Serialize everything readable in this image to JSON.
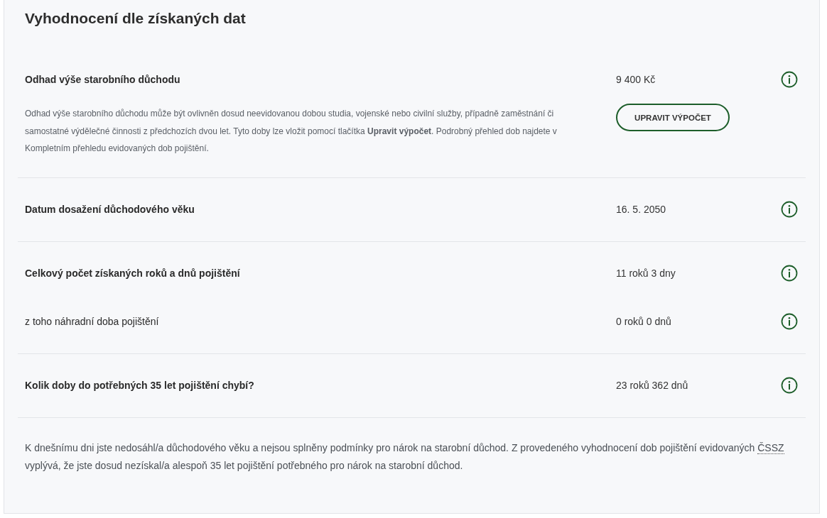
{
  "title": "Vyhodnocení dle získaných dat",
  "sections": [
    {
      "rows": [
        {
          "label": "Odhad výše starobního důchodu",
          "value": "9 400 Kč",
          "bold": true
        }
      ],
      "description": "Odhad výše starobního důchodu může být ovlivněn dosud neevidovanou dobou studia, vojenské nebo civilní služby, případně zaměstnání či samostatné výdělečné činnosti z předchozích dvou let. Tyto doby lze vložit pomocí tlačítka **Upravit výpočet**. Podrobný přehled dob najdete v Kompletním přehledu evidovaných dob pojištění.",
      "button": "UPRAVIT VÝPOČET"
    },
    {
      "rows": [
        {
          "label": "Datum dosažení důchodového věku",
          "value": "16. 5. 2050",
          "bold": true
        }
      ]
    },
    {
      "rows": [
        {
          "label": "Celkový počet získaných roků a dnů pojištění",
          "value": "11 roků 3 dny",
          "bold": true
        },
        {
          "label": "z toho náhradní doba pojištění",
          "value": "0 roků 0 dnů",
          "bold": false
        }
      ]
    },
    {
      "rows": [
        {
          "label": "Kolik doby do potřebných 35 let pojištění chybí?",
          "value": "23 roků 362 dnů",
          "bold": true
        }
      ]
    }
  ],
  "note": {
    "before": "K dnešnímu dni jste nedosáhl/a důchodového věku a nejsou splněny podmínky pro nárok na starobní důchod. Z provedeného vyhodnocení dob pojištění evidovaných",
    "abbreviation": "ČSSZ",
    "after": "vyplývá, že jste dosud nezískal/a alespoň 35 let pojištění potřebného pro nárok na starobní důchod."
  }
}
